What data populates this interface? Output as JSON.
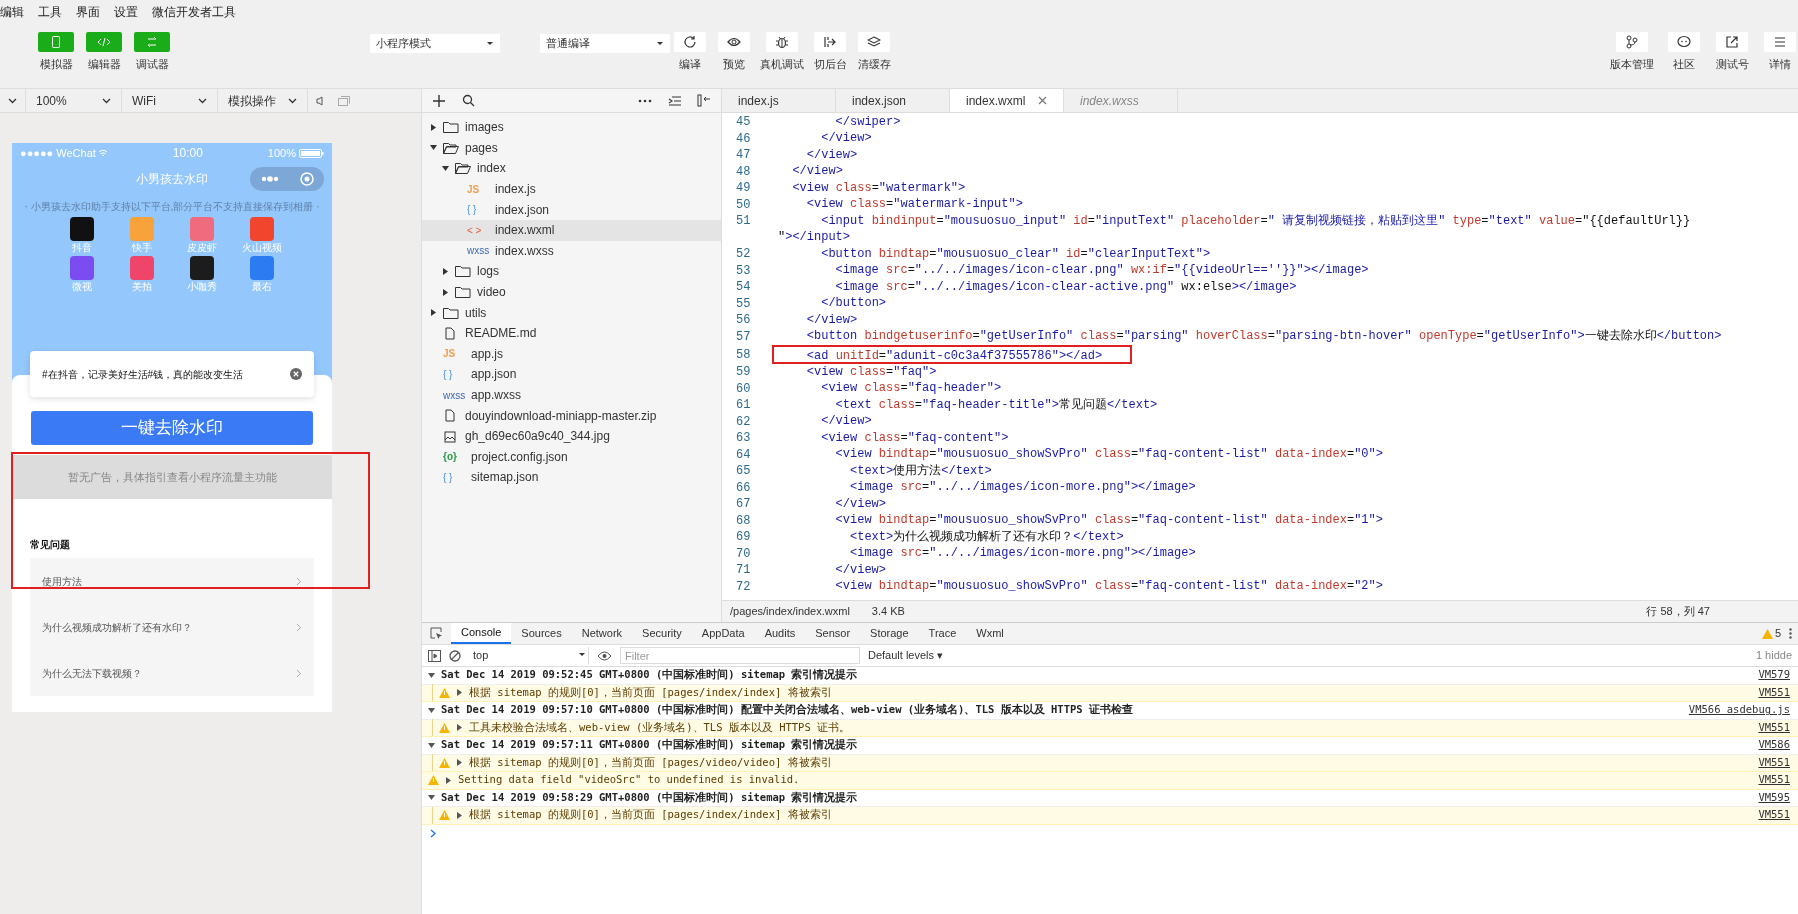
{
  "menu": [
    "编辑",
    "工具",
    "界面",
    "设置",
    "微信开发者工具"
  ],
  "toolbar": {
    "views": [
      {
        "label": "模拟器",
        "on": true
      },
      {
        "label": "编辑器",
        "on": true
      },
      {
        "label": "调试器",
        "on": true
      }
    ],
    "mode": "小程序模式",
    "compile": "普通编译",
    "actions": [
      "编译",
      "预览",
      "真机调试",
      "切后台",
      "清缓存"
    ],
    "right": [
      "版本管理",
      "社区",
      "测试号",
      "详情"
    ]
  },
  "simulator_bar": {
    "dropdowns": [
      "100%",
      "WiFi",
      "模拟操作"
    ]
  },
  "phone": {
    "carrier": "●●●●● WeChat",
    "time": "10:00",
    "battery": "100%",
    "title": "小男孩去水印",
    "subtitle": "· 小男孩去水印助手支持以下平台,部分平台不支持直接保存到相册 ·",
    "platforms": [
      {
        "name": "抖音",
        "color": "#111111"
      },
      {
        "name": "快手",
        "color": "#f7a23b"
      },
      {
        "name": "皮皮虾",
        "color": "#f06b7d"
      },
      {
        "name": "火山视频",
        "color": "#f2452d"
      },
      {
        "name": "微视",
        "color": "#7b4cf0"
      },
      {
        "name": "美拍",
        "color": "#f0456a"
      },
      {
        "name": "小咖秀",
        "color": "#1c1c1c"
      },
      {
        "name": "最右",
        "color": "#2d7bf0"
      }
    ],
    "input_value": "#在抖音，记录美好生活#钱，真的能改变生活",
    "button": "一键去除水印",
    "ad_text": "暂无广告，具体指引查看小程序流量主功能",
    "faq_title": "常见问题",
    "faq": [
      "使用方法",
      "为什么视频成功解析了还有水印？",
      "为什么无法下载视频？"
    ]
  },
  "files": [
    {
      "name": "images",
      "kind": "folder",
      "expanded": false,
      "selected": false
    },
    {
      "name": "pages",
      "kind": "folder",
      "expanded": true,
      "selected": false,
      "children": [
        {
          "name": "index",
          "kind": "folder",
          "expanded": true,
          "selected": false,
          "children": [
            {
              "name": "index.js",
              "kind": "js",
              "badge": "JS",
              "selected": false
            },
            {
              "name": "index.json",
              "kind": "json",
              "badge": "{ }",
              "selected": false
            },
            {
              "name": "index.wxml",
              "kind": "wxml",
              "badge": "< >",
              "selected": true
            },
            {
              "name": "index.wxss",
              "kind": "wxss",
              "badge": "wxss",
              "selected": false
            }
          ]
        },
        {
          "name": "logs",
          "kind": "folder",
          "expanded": false,
          "selected": false
        },
        {
          "name": "video",
          "kind": "folder",
          "expanded": false,
          "selected": false
        }
      ]
    },
    {
      "name": "utils",
      "kind": "folder",
      "expanded": false,
      "selected": false
    },
    {
      "name": "README.md",
      "kind": "file",
      "selected": false
    },
    {
      "name": "app.js",
      "kind": "js",
      "badge": "JS",
      "selected": false
    },
    {
      "name": "app.json",
      "kind": "json",
      "badge": "{ }",
      "selected": false
    },
    {
      "name": "app.wxss",
      "kind": "wxss",
      "badge": "wxss",
      "selected": false
    },
    {
      "name": "douyindownload-miniapp-master.zip",
      "kind": "file",
      "selected": false
    },
    {
      "name": "gh_d69ec60a9c40_344.jpg",
      "kind": "image",
      "selected": false
    },
    {
      "name": "project.config.json",
      "kind": "config",
      "badge": "{o}",
      "selected": false
    },
    {
      "name": "sitemap.json",
      "kind": "json",
      "badge": "{ }",
      "selected": false
    }
  ],
  "editor": {
    "tabs": [
      {
        "label": "index.js",
        "selected": false,
        "preview": false
      },
      {
        "label": "index.json",
        "selected": false,
        "preview": false
      },
      {
        "label": "index.wxml",
        "selected": true,
        "preview": false
      },
      {
        "label": "index.wxss",
        "selected": false,
        "preview": true
      }
    ],
    "lines": [
      {
        "line_number": "45",
        "code": "        </swiper>"
      },
      {
        "line_number": "46",
        "code": "      </view>"
      },
      {
        "line_number": "47",
        "code": "    </view>"
      },
      {
        "line_number": "48",
        "code": "  </view>"
      },
      {
        "line_number": "49",
        "code": "  <view class=\"watermark\">"
      },
      {
        "line_number": "50",
        "code": "    <view class=\"watermark-input\">"
      },
      {
        "line_number": "51",
        "code": "      <input bindinput=\"mousuosuo_input\" id=\"inputText\" placeholder=\" 请复制视频链接，粘贴到这里\" type=\"text\" value=\"{{defaultUrl}}"
      },
      {
        "code": "\"></input>"
      },
      {
        "line_number": "52",
        "code": "      <button bindtap=\"mousuosuo_clear\" id=\"clearInputText\">"
      },
      {
        "line_number": "53",
        "code": "        <image src=\"../../images/icon-clear.png\" wx:if=\"{{videoUrl==''}}\"></image>"
      },
      {
        "line_number": "54",
        "code": "        <image src=\"../../images/icon-clear-active.png\" wx:else></image>"
      },
      {
        "line_number": "55",
        "code": "      </button>"
      },
      {
        "line_number": "56",
        "code": "    </view>"
      },
      {
        "line_number": "57",
        "code": "    <button bindgetuserinfo=\"getUserInfo\" class=\"parsing\" hoverClass=\"parsing-btn-hover\" openType=\"getUserInfo\">一键去除水印</button>"
      },
      {
        "line_number": "58",
        "annotated": true,
        "code": "    <ad unitId=\"adunit-c0c3a4f37555786\"></ad>"
      },
      {
        "line_number": "59",
        "code": "    <view class=\"faq\">"
      },
      {
        "line_number": "60",
        "code": "      <view class=\"faq-header\">"
      },
      {
        "line_number": "61",
        "code": "        <text class=\"faq-header-title\">常见问题</text>"
      },
      {
        "line_number": "62",
        "code": "      </view>"
      },
      {
        "line_number": "63",
        "code": "      <view class=\"faq-content\">"
      },
      {
        "line_number": "64",
        "code": "        <view bindtap=\"mousuosuo_showSvPro\" class=\"faq-content-list\" data-index=\"0\">"
      },
      {
        "line_number": "65",
        "code": "          <text>使用方法</text>"
      },
      {
        "line_number": "66",
        "code": "          <image src=\"../../images/icon-more.png\"></image>"
      },
      {
        "line_number": "67",
        "code": "        </view>"
      },
      {
        "line_number": "68",
        "code": "        <view bindtap=\"mousuosuo_showSvPro\" class=\"faq-content-list\" data-index=\"1\">"
      },
      {
        "line_number": "69",
        "code": "          <text>为什么视频成功解析了还有水印？</text>"
      },
      {
        "line_number": "70",
        "code": "          <image src=\"../../images/icon-more.png\"></image>"
      },
      {
        "line_number": "71",
        "code": "        </view>"
      },
      {
        "line_number": "72",
        "code": "        <view bindtap=\"mousuosuo_showSvPro\" class=\"faq-content-list\" data-index=\"2\">"
      }
    ],
    "status": {
      "path": "/pages/index/index.wxml",
      "size": "3.4 KB",
      "position": "行 58，列 47"
    }
  },
  "console": {
    "tabs": [
      {
        "label": "Console",
        "selected": true
      },
      {
        "label": "Sources",
        "selected": false
      },
      {
        "label": "Network",
        "selected": false
      },
      {
        "label": "Security",
        "selected": false
      },
      {
        "label": "AppData",
        "selected": false
      },
      {
        "label": "Audits",
        "selected": false
      },
      {
        "label": "Sensor",
        "selected": false
      },
      {
        "label": "Storage",
        "selected": false
      },
      {
        "label": "Trace",
        "selected": false
      },
      {
        "label": "Wxml",
        "selected": false
      }
    ],
    "warning_count": "5",
    "context": "top",
    "filter_placeholder": "Filter",
    "levels": "Default levels ▾",
    "hidden": "1 hidde",
    "logs": [
      {
        "kind": "group",
        "text": "Sat Dec 14 2019 09:52:45 GMT+0800 (中国标准时间) sitemap 索引情况提示",
        "source": "VM579"
      },
      {
        "kind": "group-warning",
        "text": "根据 sitemap 的规则[0]，当前页面 [pages/index/index] 将被索引",
        "source": "VM551"
      },
      {
        "kind": "group",
        "text": "Sat Dec 14 2019 09:57:10 GMT+0800 (中国标准时间) 配置中关闭合法域名、web-view (业务域名)、TLS 版本以及 HTTPS 证书检查",
        "source": "VM566 asdebug.js"
      },
      {
        "kind": "group-warning",
        "text": "工具未校验合法域名、web-view (业务域名)、TLS 版本以及 HTTPS 证书。",
        "source": "VM551"
      },
      {
        "kind": "group",
        "text": "Sat Dec 14 2019 09:57:11 GMT+0800 (中国标准时间) sitemap 索引情况提示",
        "source": "VM586"
      },
      {
        "kind": "group-warning",
        "text": "根据 sitemap 的规则[0]，当前页面 [pages/video/video] 将被索引",
        "source": "VM551"
      },
      {
        "kind": "warning",
        "text": "Setting data field \"videoSrc\" to undefined is invalid.",
        "source": "VM551"
      },
      {
        "kind": "group",
        "text": "Sat Dec 14 2019 09:58:29 GMT+0800 (中国标准时间) sitemap 索引情况提示",
        "source": "VM595"
      },
      {
        "kind": "group-warning",
        "text": "根据 sitemap 的规则[0]，当前页面 [pages/index/index] 将被索引",
        "source": "VM551"
      }
    ]
  }
}
